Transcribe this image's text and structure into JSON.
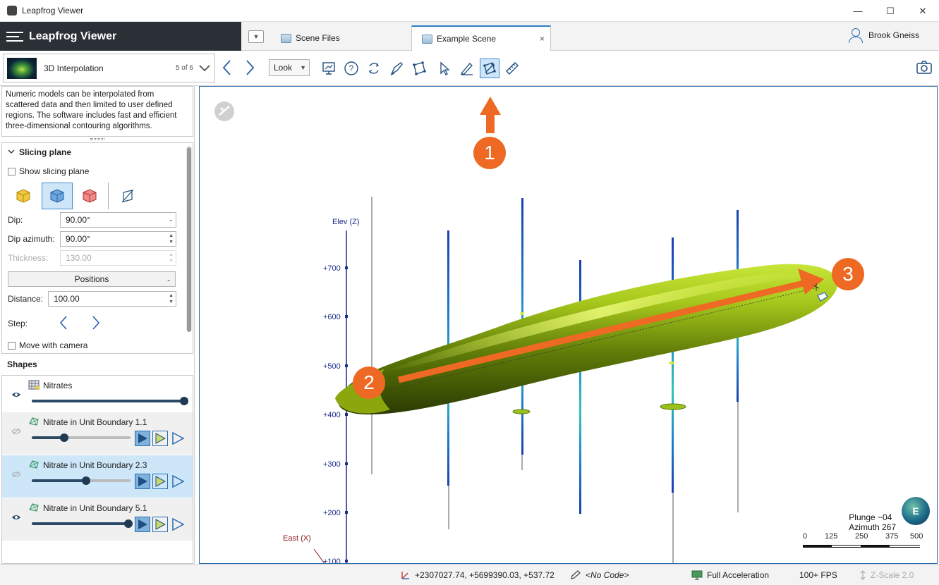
{
  "window": {
    "title": "Leapfrog Viewer",
    "minimize": "—",
    "maximize": "☐",
    "close": "✕"
  },
  "brand": {
    "name": "Leapfrog Viewer"
  },
  "tabs": [
    {
      "label": "Scene Files"
    },
    {
      "label": "Example Scene"
    }
  ],
  "tab_close": "×",
  "user": {
    "name": "Brook Gneiss"
  },
  "scene": {
    "name": "3D Interpolation",
    "count": "5 of 6"
  },
  "look": {
    "label": "Look"
  },
  "description": "Numeric models can be interpolated from scattered data and then limited to user defined regions. The software includes fast and efficient three-dimensional contouring algorithms.",
  "slicing": {
    "header": "Slicing plane",
    "show_label": "Show slicing plane",
    "dip_label": "Dip:",
    "dip_value": "90.00°",
    "dip_azimuth_label": "Dip azimuth:",
    "dip_azimuth_value": "90.00°",
    "thickness_label": "Thickness:",
    "thickness_value": "130.00",
    "positions_label": "Positions",
    "distance_label": "Distance:",
    "distance_value": "100.00",
    "step_label": "Step:",
    "move_label": "Move with camera"
  },
  "shapes": {
    "header": "Shapes",
    "items": [
      {
        "name": "Nitrates",
        "opacity": 1.0,
        "visible": true
      },
      {
        "name": "Nitrate in Unit Boundary 1.1",
        "opacity": 0.33,
        "visible": false
      },
      {
        "name": "Nitrate in Unit Boundary 2.3",
        "opacity": 0.55,
        "visible": false
      },
      {
        "name": "Nitrate in Unit Boundary 5.1",
        "opacity": 1.0,
        "visible": true
      }
    ]
  },
  "viewport": {
    "elev_label": "Elev (Z)",
    "east_label": "East (X)",
    "elev_ticks": [
      "+700",
      "+600",
      "+500",
      "+400",
      "+300",
      "+200",
      "+100"
    ],
    "plunge": "Plunge −04",
    "azimuth": "Azimuth 267",
    "compass_letter": "E",
    "scale_ticks": [
      "0",
      "125",
      "250",
      "375",
      "500"
    ],
    "callouts": [
      "1",
      "2",
      "3"
    ]
  },
  "status": {
    "coords": "+2307027.74, +5699390.03, +537.72",
    "code": "<No Code>",
    "acceleration": "Full Acceleration",
    "fps": "100+ FPS",
    "zscale": "Z-Scale 2.0"
  },
  "colors": {
    "accent": "#2b6cb0",
    "callout": "#ee6a24",
    "brand_bg": "#2b2f36",
    "model": "#9bc21a"
  }
}
